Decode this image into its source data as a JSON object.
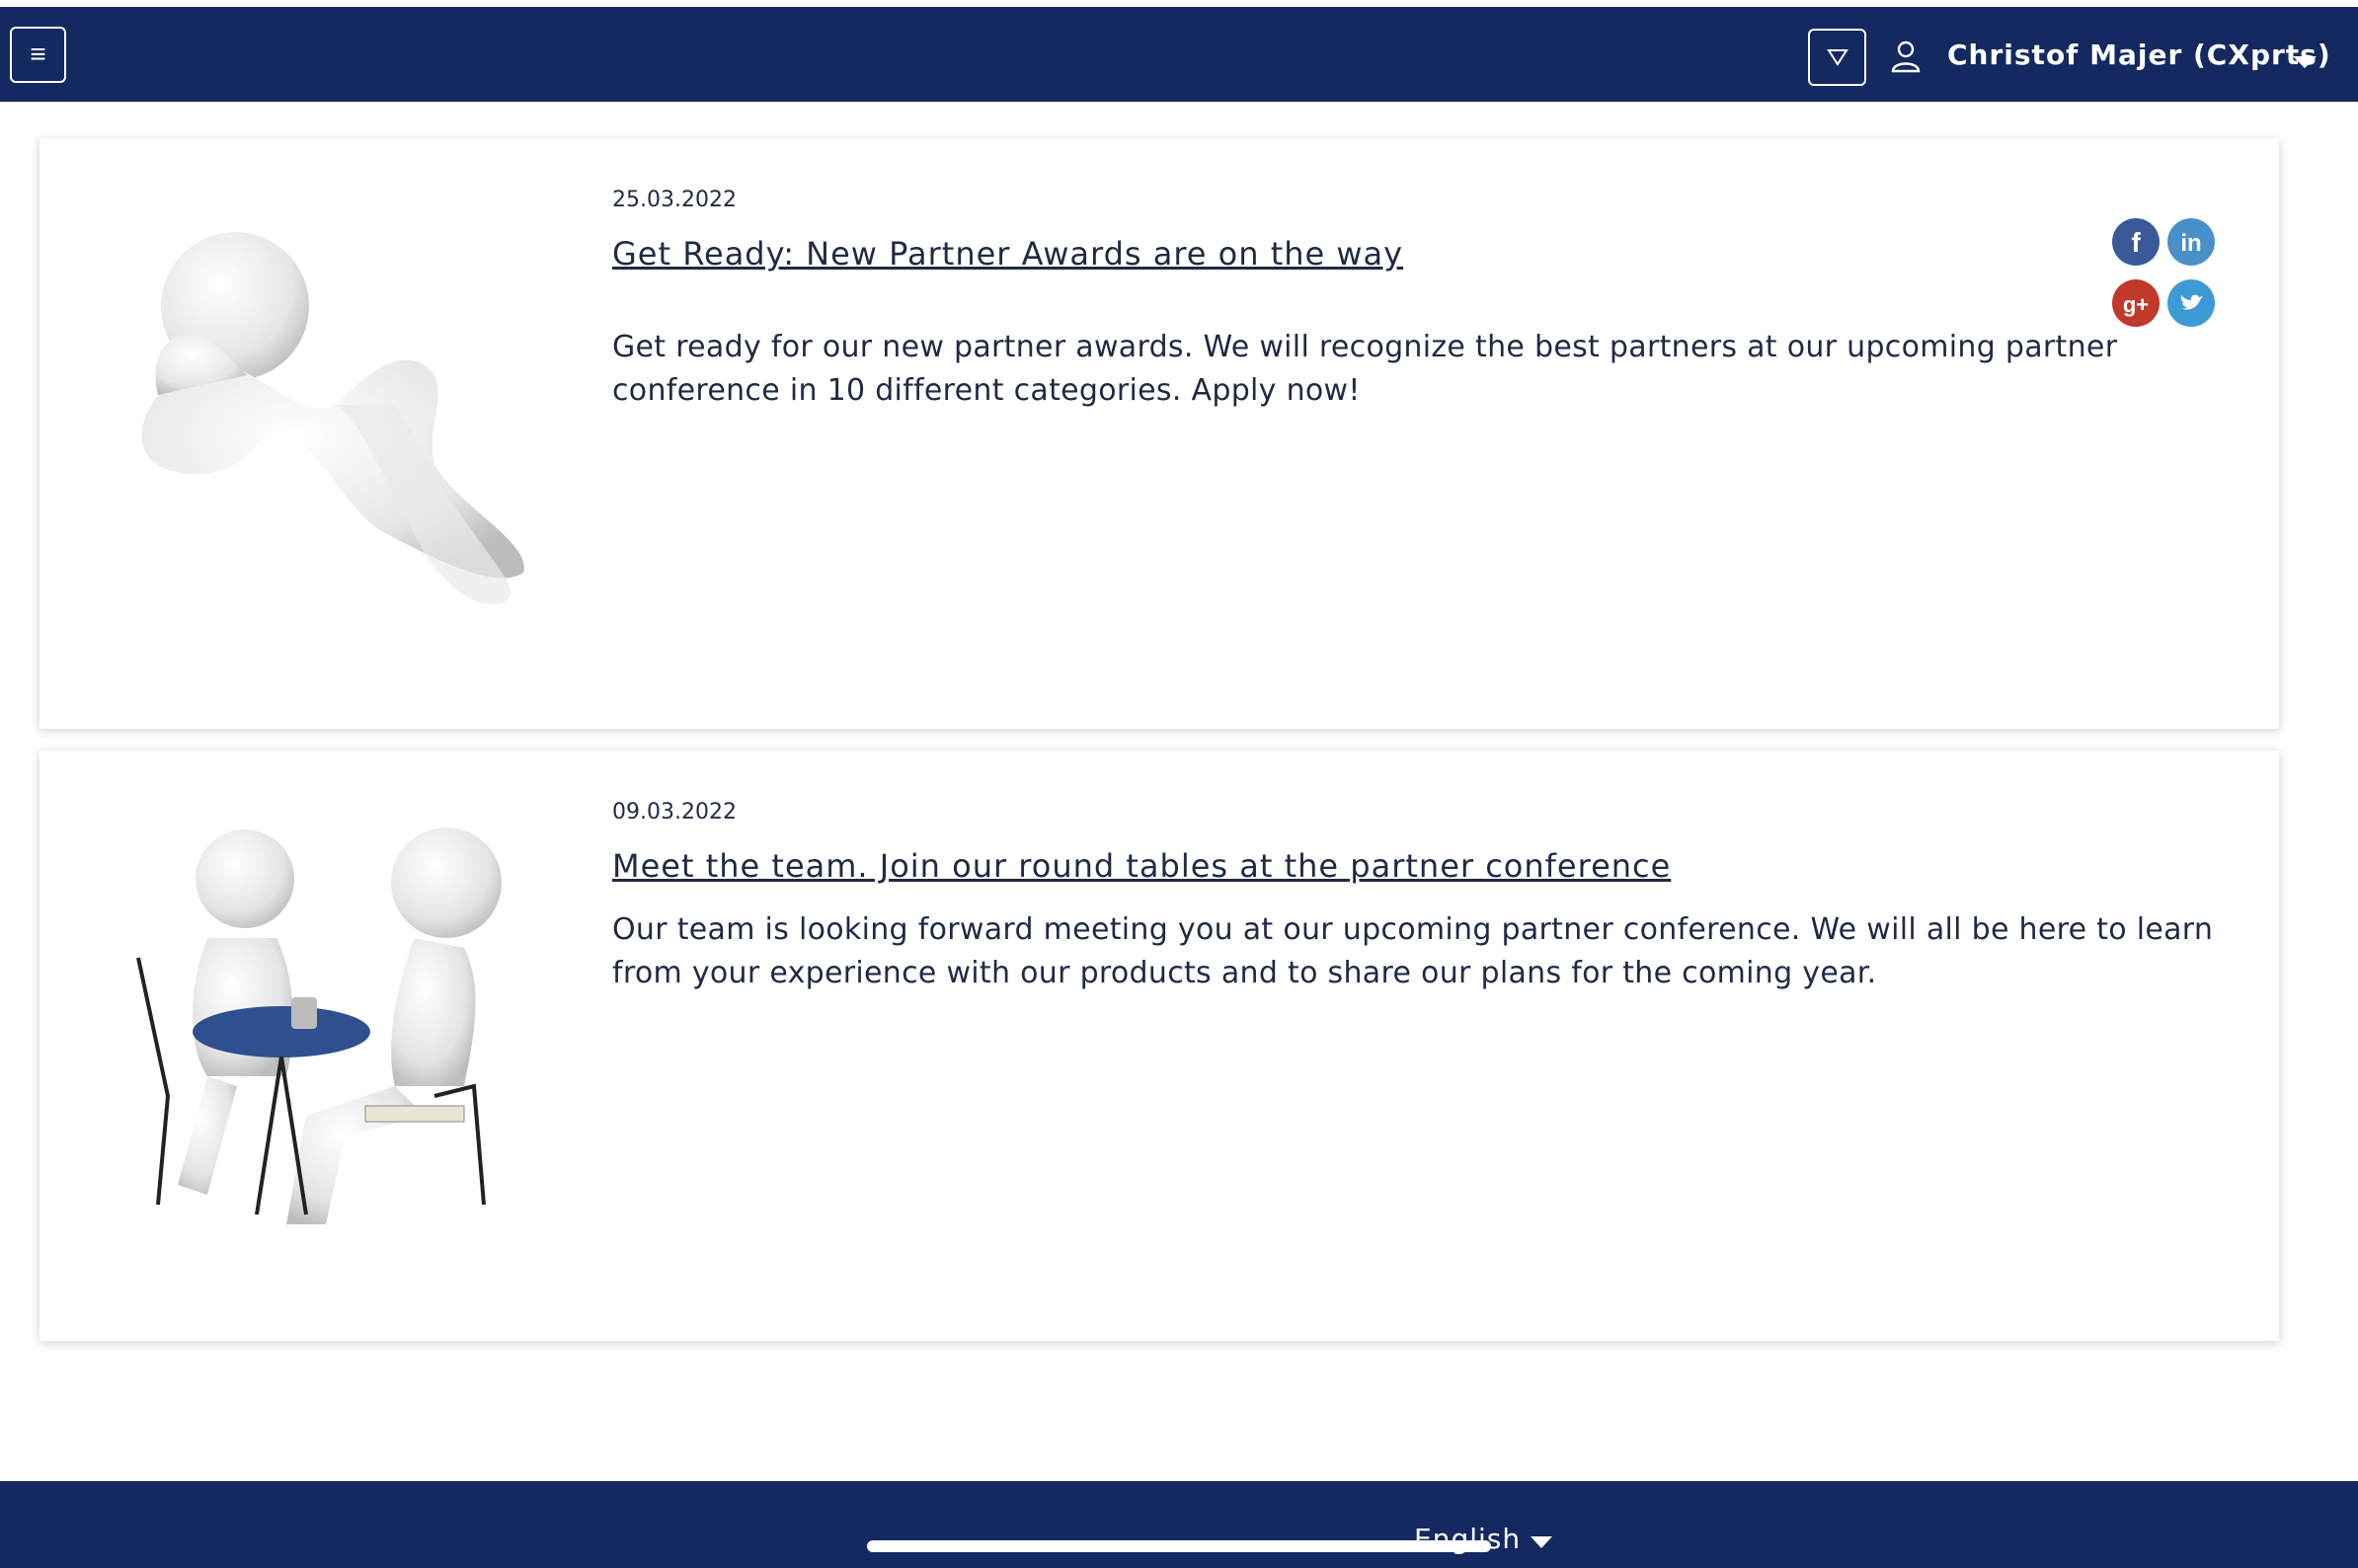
{
  "header": {
    "menu_icon": "≡",
    "filter_icon": "▽",
    "user_name": "Christof Majer (CXprts)"
  },
  "news": [
    {
      "date": "25.03.2022",
      "title": "Get Ready: New Partner Awards are on the way",
      "text": "Get ready for our new partner awards. We will recognize the best partners at our upcoming partner conference in 10 different categories. Apply now!"
    },
    {
      "date": "09.03.2022",
      "title": "Meet the team. Join our round tables at the partner conference",
      "text": "Our team is looking forward meeting you at our upcoming partner conference. We will all be here to learn from your experience with our products and to share our plans for the coming year."
    }
  ],
  "social": {
    "icons": [
      "facebook-icon",
      "linkedin-icon",
      "google-plus-icon",
      "twitter-icon"
    ],
    "colors": {
      "facebook": "#3b5998",
      "linkedin": "#4a90c8",
      "googleplus": "#c0392b",
      "twitter": "#3d9ad6"
    }
  },
  "footer": {
    "language": "English"
  },
  "colors": {
    "brand": "#14295f",
    "text": "#1f2a44",
    "table_blue": "#2f4f8f"
  }
}
